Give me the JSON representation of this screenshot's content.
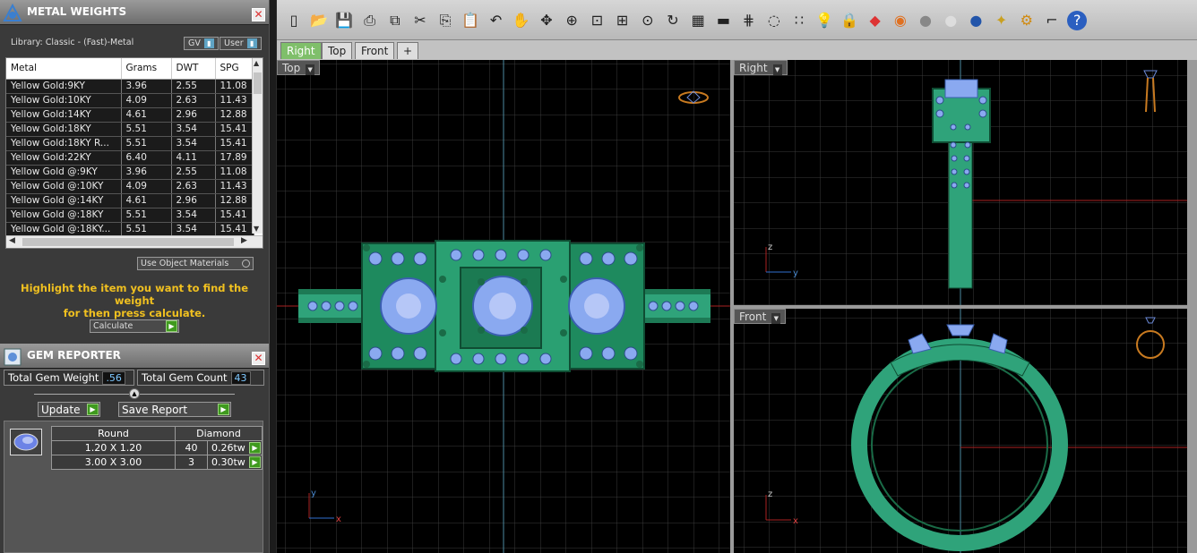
{
  "metal_panel": {
    "title": "METAL WEIGHTS",
    "library": "Library: Classic - (Fast)-Metal",
    "chip_gv": "GV",
    "chip_user": "User",
    "columns": [
      "Metal",
      "Grams",
      "DWT",
      "SPG"
    ],
    "rows": [
      [
        "Yellow Gold:9KY",
        "3.96",
        "2.55",
        "11.08"
      ],
      [
        "Yellow Gold:10KY",
        "4.09",
        "2.63",
        "11.43"
      ],
      [
        "Yellow Gold:14KY",
        "4.61",
        "2.96",
        "12.88"
      ],
      [
        "Yellow Gold:18KY",
        "5.51",
        "3.54",
        "15.41"
      ],
      [
        "Yellow Gold:18KY R...",
        "5.51",
        "3.54",
        "15.41"
      ],
      [
        "Yellow Gold:22KY",
        "6.40",
        "4.11",
        "17.89"
      ],
      [
        "Yellow Gold @:9KY",
        "3.96",
        "2.55",
        "11.08"
      ],
      [
        "Yellow Gold @:10KY",
        "4.09",
        "2.63",
        "11.43"
      ],
      [
        "Yellow Gold @:14KY",
        "4.61",
        "2.96",
        "12.88"
      ],
      [
        "Yellow Gold @:18KY",
        "5.51",
        "3.54",
        "15.41"
      ],
      [
        "Yellow Gold @:18KY...",
        "5.51",
        "3.54",
        "15.41"
      ]
    ],
    "use_object_materials": "Use Object Materials",
    "hint_line1": "Highlight the item you want to find the weight",
    "hint_line2": "for then press calculate.",
    "calculate": "Calculate"
  },
  "gem_panel": {
    "title": "GEM REPORTER",
    "total_weight_label": "Total Gem Weight",
    "total_weight_value": ".56",
    "total_count_label": "Total Gem Count",
    "total_count_value": "43",
    "update": "Update",
    "save_report": "Save Report",
    "header_shape": "Round",
    "header_type": "Diamond",
    "rows": [
      {
        "size": "1.20 X 1.20",
        "count": "40",
        "weight": "0.26tw"
      },
      {
        "size": "3.00 X 3.00",
        "count": "3",
        "weight": "0.30tw"
      }
    ]
  },
  "tabs": [
    "Right",
    "Top",
    "Front",
    "+"
  ],
  "viewports": {
    "top": "Top",
    "right": "Right",
    "front": "Front"
  },
  "axes": {
    "x": "x",
    "y": "y",
    "z": "z"
  },
  "colors": {
    "metal": "#2fa37a",
    "gem": "#8aa9f0",
    "grid": "#3a3a3a",
    "hint": "#f0c020"
  },
  "toolbar_icons": [
    "new-icon",
    "open-icon",
    "save-icon",
    "print-icon",
    "export-icon",
    "cut-icon",
    "copy-icon",
    "paste-icon",
    "undo-icon",
    "pan-icon",
    "rotate-view-icon",
    "zoom-icon",
    "zoom-window-icon",
    "zoom-extents-icon",
    "zoom-selected-icon",
    "rotate-icon",
    "four-views-icon",
    "car-icon",
    "grid-icon",
    "snap-icon",
    "points-icon",
    "light-icon",
    "lock-icon",
    "material-icon",
    "color-wheel-icon",
    "shade-gray-icon",
    "shade-white-icon",
    "shade-blue-icon",
    "wand-icon",
    "settings-icon",
    "dimension-icon",
    "help-icon"
  ]
}
